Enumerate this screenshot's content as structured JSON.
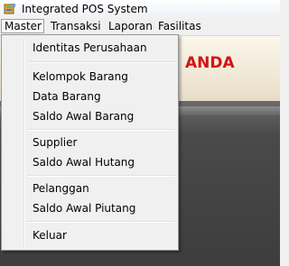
{
  "window": {
    "title": "Integrated POS System"
  },
  "menubar": {
    "items": [
      {
        "label": "Master"
      },
      {
        "label": "Transaksi"
      },
      {
        "label": "Laporan"
      },
      {
        "label": "Fasilitas"
      }
    ]
  },
  "banner": {
    "text": "ANDA"
  },
  "master_menu": {
    "items": [
      {
        "label": "Identitas Perusahaan"
      },
      {
        "label": "Kelompok Barang"
      },
      {
        "label": "Data Barang"
      },
      {
        "label": "Saldo Awal Barang"
      },
      {
        "label": "Supplier"
      },
      {
        "label": "Saldo Awal Hutang"
      },
      {
        "label": "Pelanggan"
      },
      {
        "label": "Saldo Awal Piutang"
      },
      {
        "label": "Keluar"
      }
    ]
  }
}
